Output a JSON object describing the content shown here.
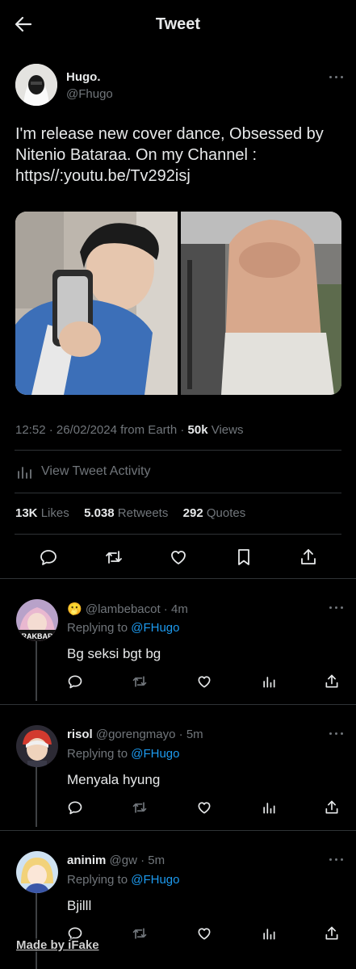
{
  "header": {
    "title": "Tweet"
  },
  "tweet": {
    "author_name": "Hugo.",
    "author_handle": "@Fhugo",
    "text_line1": "I'm release new cover dance, Obsessed by",
    "text_line2": "Nitenio Bataraa. On my Channel :",
    "text_line3": "https//:youtu.be/Tv292isj",
    "time": "12:52",
    "date": "26/02/2024",
    "source": "from Earth",
    "views_count": "50k",
    "views_label": "Views",
    "activity_label": "View Tweet Activity",
    "likes_count": "13K",
    "likes_label": "Likes",
    "retweets_count": "5.038",
    "retweets_label": "Retweets",
    "quotes_count": "292",
    "quotes_label": "Quotes"
  },
  "replies": [
    {
      "name": "🫢",
      "handle": "@lambebacot",
      "age": "4m",
      "replying_prefix": "Replying to",
      "replying_to": "@FHugo",
      "text": "Bg seksi bgt bg"
    },
    {
      "name": "risol",
      "handle": "@gorengmayo",
      "age": "5m",
      "replying_prefix": "Replying to",
      "replying_to": "@FHugo",
      "text": "Menyala hyung"
    },
    {
      "name": "aninim",
      "handle": "@gw",
      "age": "5m",
      "replying_prefix": "Replying to",
      "replying_to": "@FHugo",
      "text": "Bjilll"
    }
  ],
  "watermark": "Made by iFake",
  "colors": {
    "accent": "#1d9bf0",
    "background": "#000000",
    "muted": "#71767b",
    "divider": "#2f3336"
  }
}
